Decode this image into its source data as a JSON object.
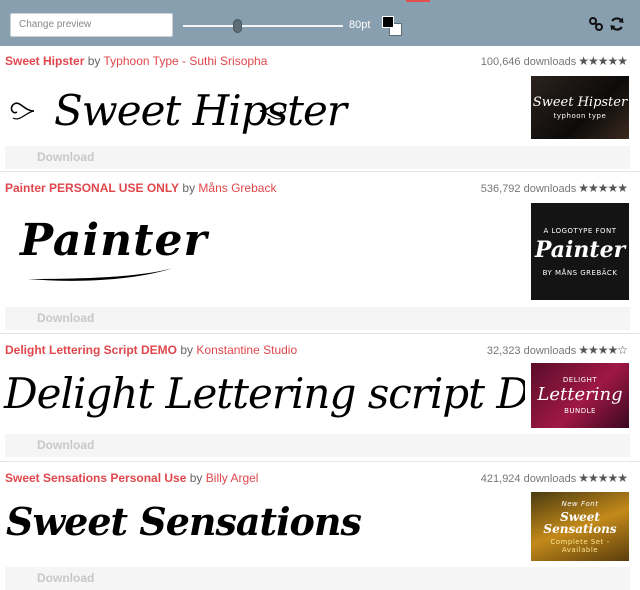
{
  "toolbar": {
    "preview_placeholder": "Change preview",
    "size_label": "80pt",
    "size_value": 80,
    "slider_fraction": 0.34,
    "fg_color": "#000000",
    "bg_color": "#ffffff",
    "link_icon": "link-icon",
    "refresh_icon": "refresh-icon"
  },
  "fonts": [
    {
      "name": "Sweet Hipster",
      "by": "by",
      "designer": "Typhoon Type - Suthi Srisopha",
      "downloads": "100,646 downloads",
      "stars": "★★★★★",
      "preview": "Sweet Hipster",
      "thumb_title": "Sweet Hipster",
      "thumb_sub": "typhoon type",
      "download_label": "Download"
    },
    {
      "name": "Painter PERSONAL USE ONLY",
      "by": "by",
      "designer": "Måns Greback",
      "downloads": "536,792 downloads",
      "stars": "★★★★★",
      "preview": "Painter",
      "thumb_top": "A LOGOTYPE FONT",
      "thumb_title": "Painter",
      "thumb_sub": "BY MÅNS GREBÄCK",
      "download_label": "Download"
    },
    {
      "name": "Delight Lettering Script DEMO",
      "by": "by",
      "designer": "Konstantine Studio",
      "downloads": "32,323 downloads",
      "stars": "★★★★☆",
      "preview": "Delight Lettering script Demo re",
      "thumb_top": "DELIGHT",
      "thumb_title": "Lettering",
      "thumb_sub": "BUNDLE",
      "download_label": "Download"
    },
    {
      "name": "Sweet Sensations Personal Use",
      "by": "by",
      "designer": "Billy Argel",
      "downloads": "421,924 downloads",
      "stars": "★★★★★",
      "preview": "Sweet Sensations",
      "thumb_top": "New Font",
      "thumb_title": "Sweet Sensations",
      "thumb_sub": "Complete Set - Available",
      "download_label": "Download"
    }
  ]
}
